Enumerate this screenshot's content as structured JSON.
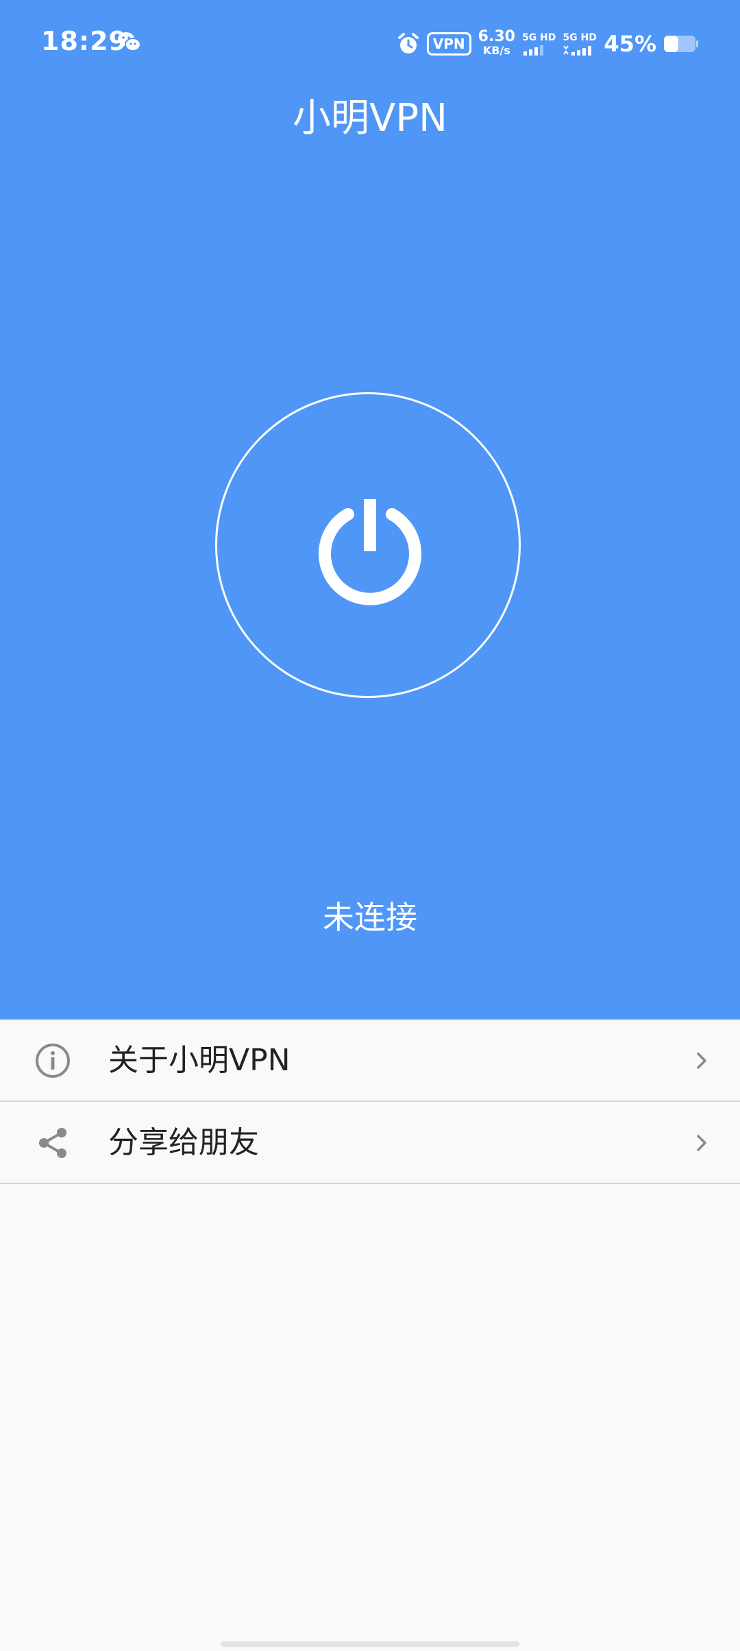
{
  "status_bar": {
    "time": "18:29",
    "vpn_badge": "VPN",
    "net_speed_value": "6.30",
    "net_speed_unit": "KB/s",
    "sim1_label": "5G HD",
    "sim2_label": "5G HD",
    "battery_percent": "45%",
    "battery_level": 0.45,
    "icons": [
      "wechat-icon",
      "alarm-icon",
      "signal-icon",
      "battery-icon"
    ]
  },
  "header": {
    "title": "小明VPN"
  },
  "connection": {
    "status_text": "未连接",
    "power_icon": "power-icon"
  },
  "menu": {
    "items": [
      {
        "label": "关于小明VPN",
        "icon": "info-icon"
      },
      {
        "label": "分享给朋友",
        "icon": "share-icon"
      }
    ]
  },
  "colors": {
    "primary": "#5096f6",
    "background": "#f9f9f9",
    "divider": "#d6d6d6",
    "icon_gray": "#8a8a8a"
  }
}
